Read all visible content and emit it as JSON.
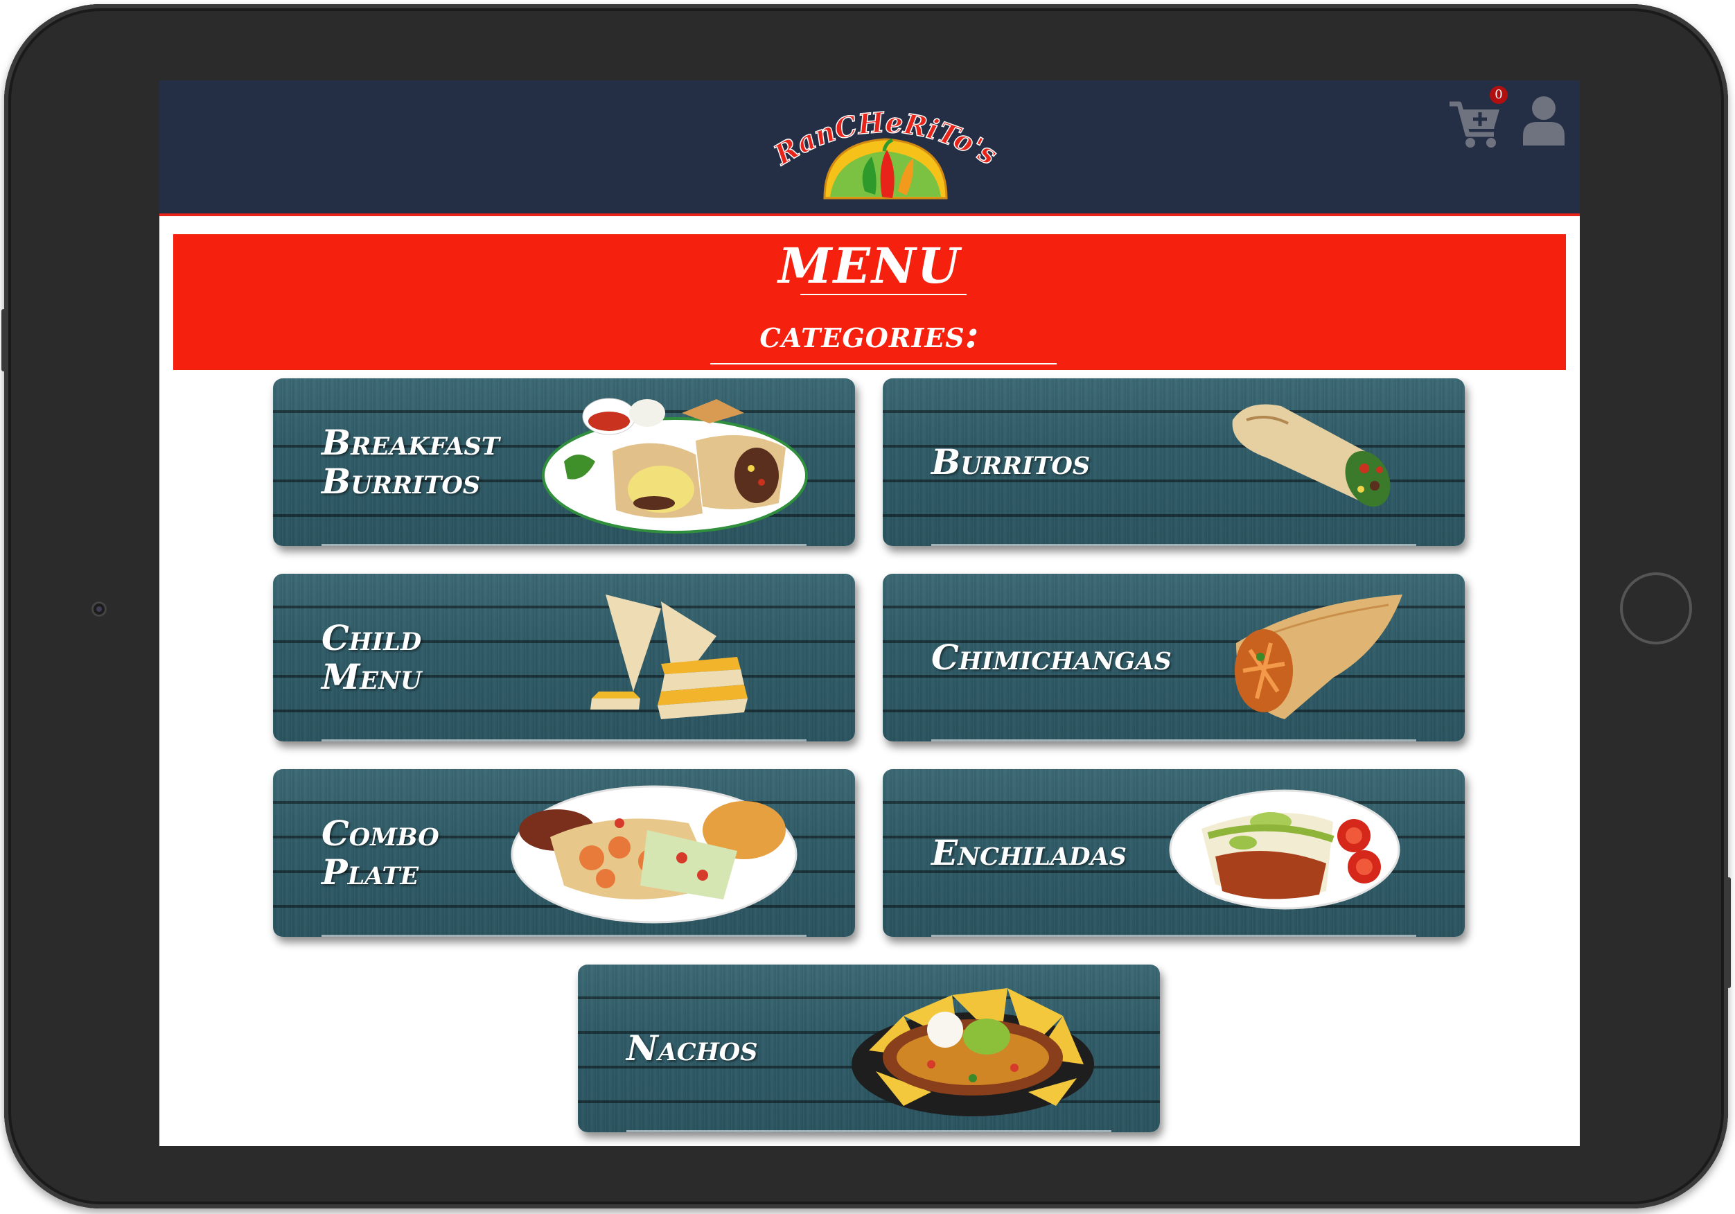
{
  "header": {
    "logo_text": "RanCHeRiTo's",
    "cart_count": "0",
    "icons": [
      "cart-icon",
      "user-icon"
    ]
  },
  "menu": {
    "title": "MENU",
    "subtitle": "categories:"
  },
  "categories": [
    {
      "label": "Breakfast\nBurritos"
    },
    {
      "label": "Burritos"
    },
    {
      "label": "Child\nMenu"
    },
    {
      "label": "Chimichangas"
    },
    {
      "label": "Combo\nPlate"
    },
    {
      "label": "Enchiladas"
    },
    {
      "label": "Nachos"
    }
  ],
  "colors": {
    "header_bg": "#242e45",
    "banner_red": "#f5200d",
    "card_wood": "#2f5c68",
    "frame": "#2b2b2b"
  }
}
